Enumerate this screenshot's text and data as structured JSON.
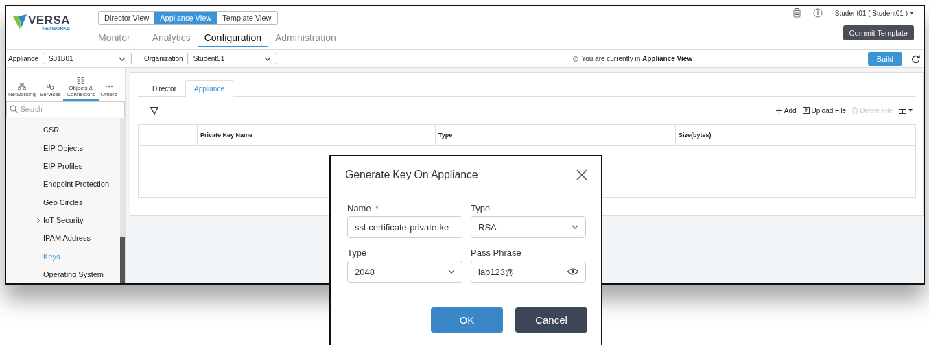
{
  "header": {
    "logo": {
      "name": "VERSA",
      "tagline": "NETWORKS"
    },
    "view_switch": [
      {
        "label": "Director View",
        "selected": false
      },
      {
        "label": "Appliance View",
        "selected": true
      },
      {
        "label": "Template View",
        "selected": false
      }
    ],
    "nav": [
      {
        "label": "Monitor",
        "selected": false
      },
      {
        "label": "Analytics",
        "selected": false
      },
      {
        "label": "Configuration",
        "selected": true
      },
      {
        "label": "Administration",
        "selected": false
      }
    ],
    "user": "Student01 ( Student01 )",
    "commit_button": "Commit Template"
  },
  "context_bar": {
    "appliance_label": "Appliance",
    "appliance_value": "S01B01",
    "organization_label": "Organization",
    "organization_value": "Student01",
    "notice": "You are currently in **Appliance View**",
    "build_button": "Build"
  },
  "sidebar": {
    "categories": [
      {
        "label": "Networking",
        "kind": "network",
        "selected": false
      },
      {
        "label": "Services",
        "kind": "services",
        "selected": false
      },
      {
        "label": "Objects & Connectors",
        "kind": "objects",
        "selected": true
      },
      {
        "label": "Others",
        "kind": "others",
        "selected": false
      }
    ],
    "search": {
      "placeholder": "Search"
    },
    "items": [
      {
        "label": "CSR",
        "selected": false,
        "expandable": false
      },
      {
        "label": "EIP Objects",
        "selected": false,
        "expandable": false
      },
      {
        "label": "EIP Profiles",
        "selected": false,
        "expandable": false
      },
      {
        "label": "Endpoint Protection",
        "selected": false,
        "expandable": false
      },
      {
        "label": "Geo Circles",
        "selected": false,
        "expandable": false
      },
      {
        "label": "IoT Security",
        "selected": false,
        "expandable": true
      },
      {
        "label": "IPAM Address",
        "selected": false,
        "expandable": false
      },
      {
        "label": "Keys",
        "selected": true,
        "expandable": false
      },
      {
        "label": "Operating System",
        "selected": false,
        "expandable": false
      }
    ]
  },
  "main": {
    "tabs": [
      {
        "label": "Director",
        "selected": false
      },
      {
        "label": "Appliance",
        "selected": true
      }
    ],
    "toolbar": [
      {
        "label": "Add",
        "kind": "add",
        "disabled": false
      },
      {
        "label": "Upload File",
        "kind": "upload",
        "disabled": false
      },
      {
        "label": "Delete File",
        "kind": "delete",
        "disabled": true
      }
    ],
    "table": {
      "columns": [
        "Private Key Name",
        "Type",
        "Size(bytes)"
      ]
    }
  },
  "dialog": {
    "title": "Generate Key On Appliance",
    "fields": [
      {
        "label": "Name",
        "required_mark": "*",
        "kind": "text",
        "value": "ssl-certificate-private-ke"
      },
      {
        "label": "Type",
        "kind": "select",
        "value": "RSA"
      },
      {
        "label": "Type",
        "kind": "select",
        "value": "2048"
      },
      {
        "label": "Pass Phrase",
        "kind": "password",
        "value": "lab123@"
      }
    ],
    "buttons": [
      {
        "label": "OK",
        "kind": "primary"
      },
      {
        "label": "Cancel",
        "kind": "secondary"
      }
    ]
  }
}
